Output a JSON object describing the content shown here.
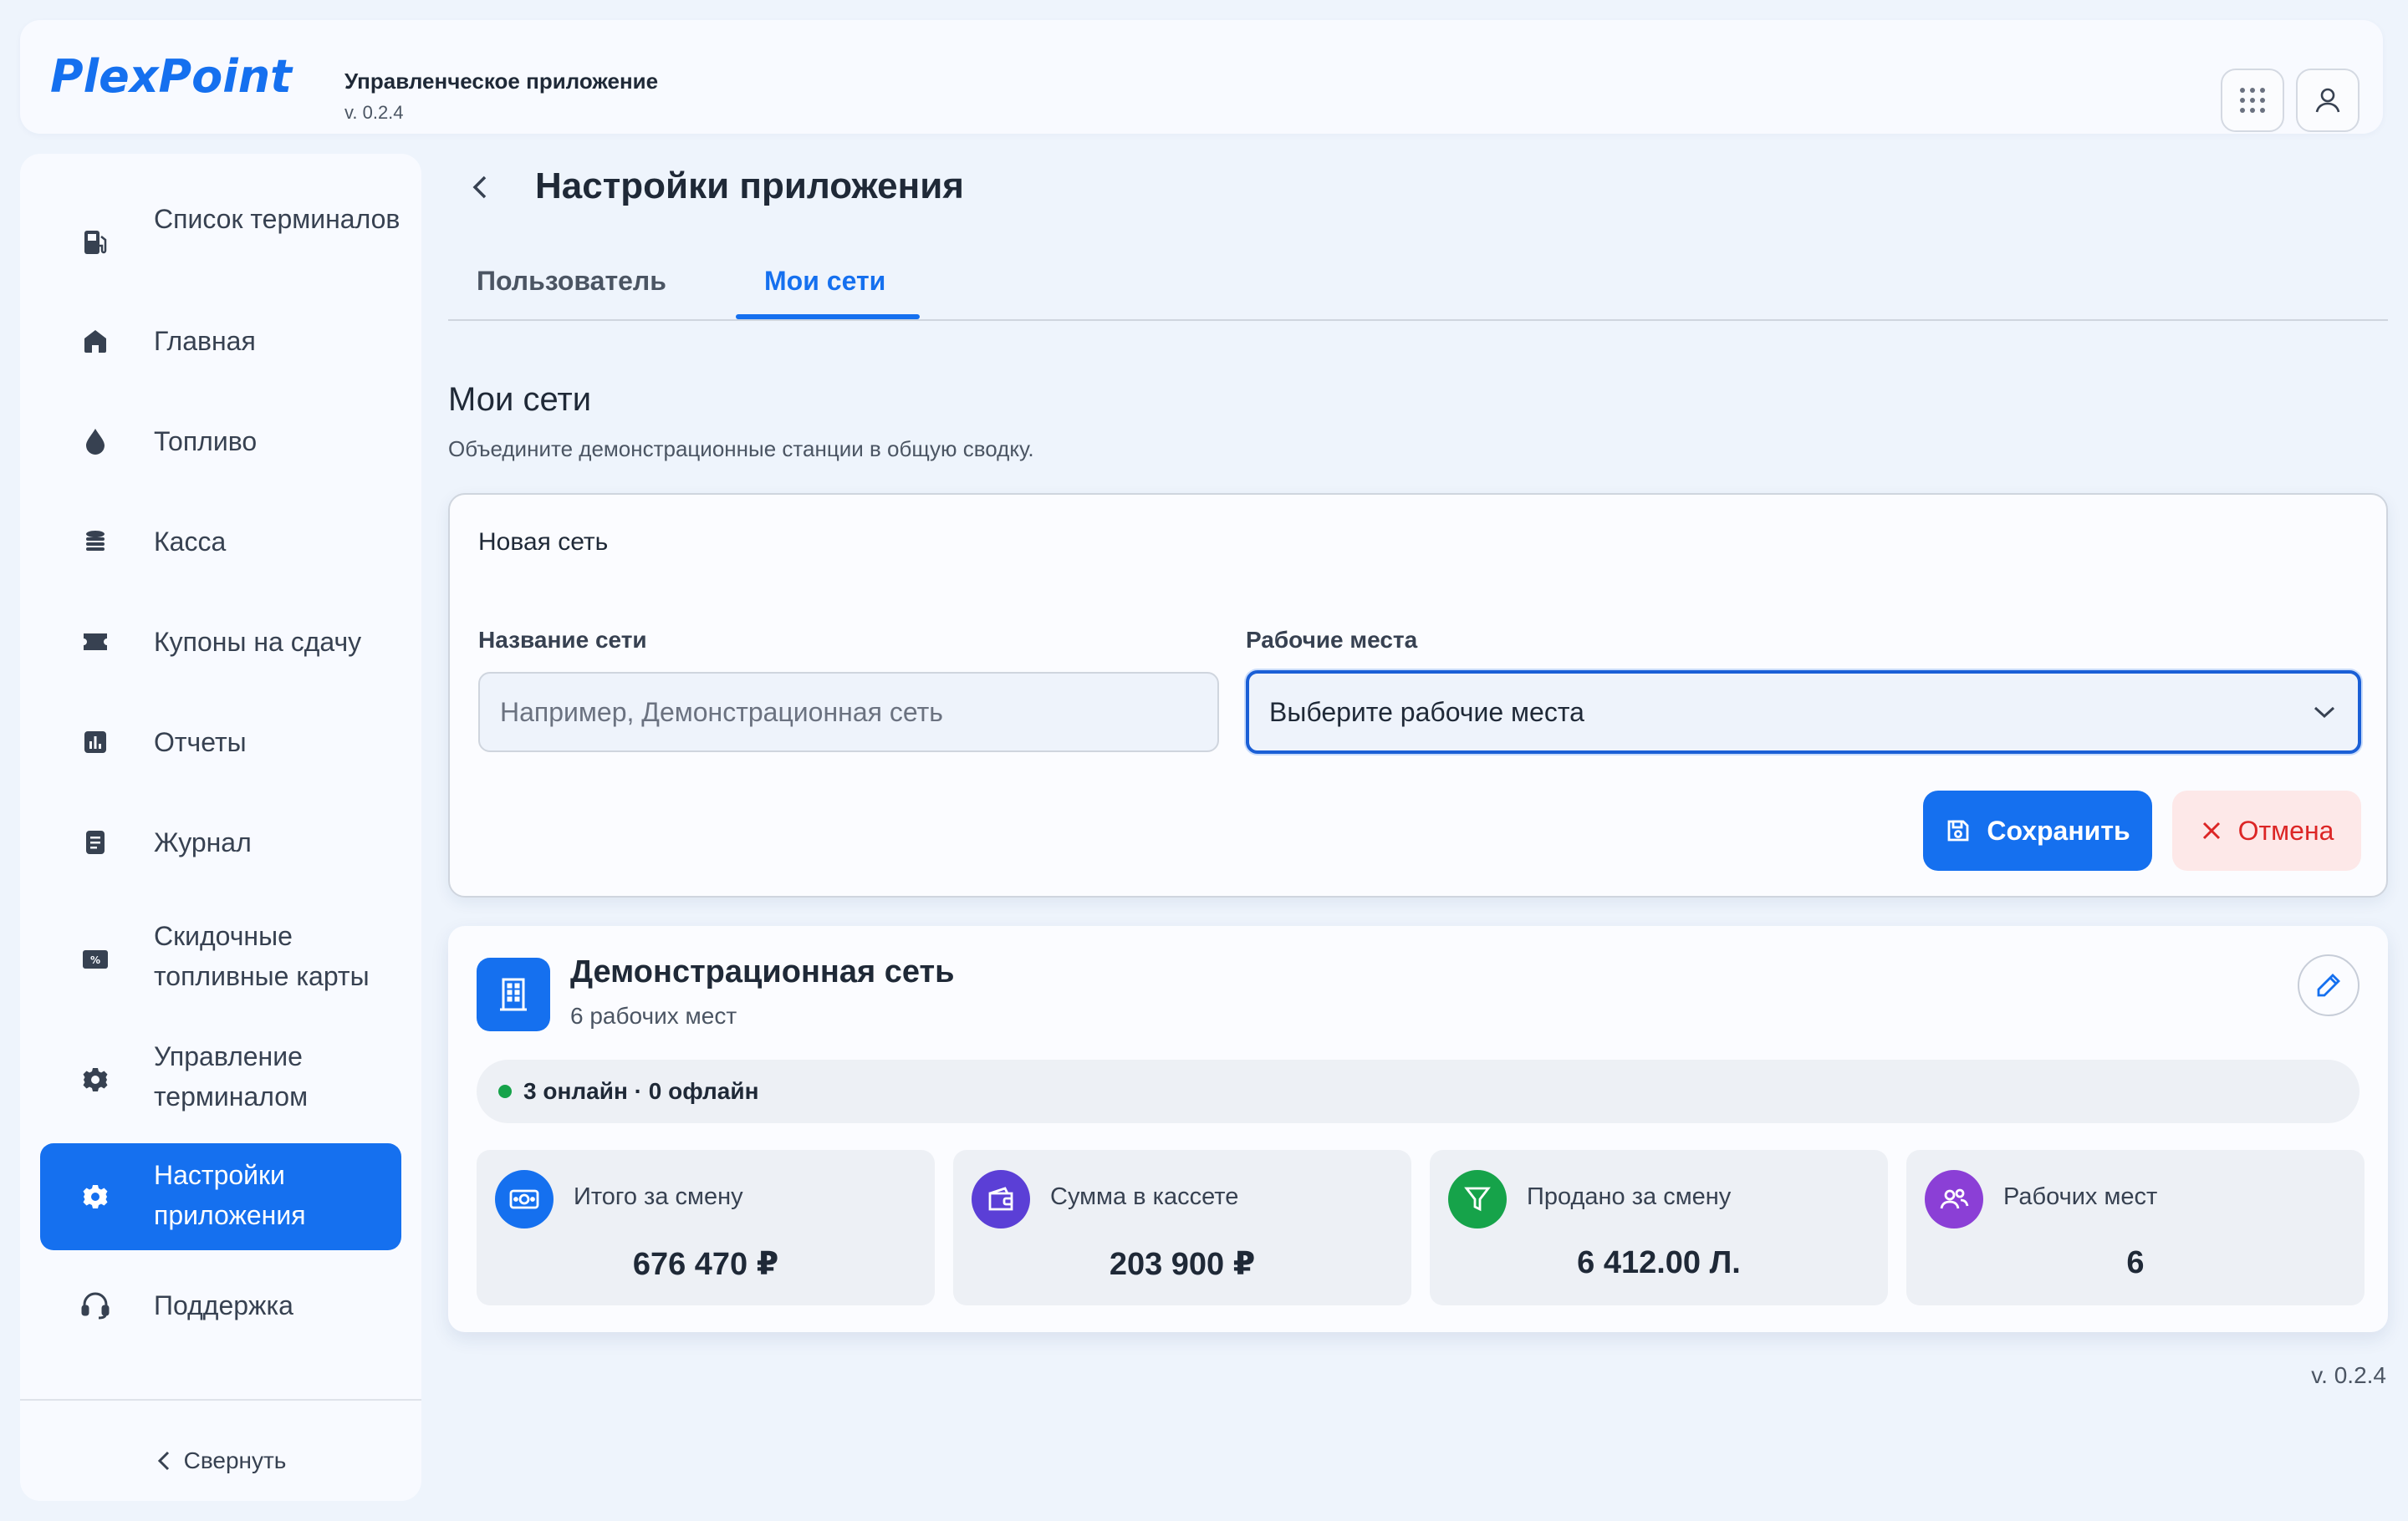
{
  "header": {
    "logo_text": "PlexPoint",
    "app_title": "Управленческое приложение",
    "version": "v. 0.2.4",
    "icons": [
      "apps-grid-icon",
      "user-icon"
    ]
  },
  "sidebar": {
    "items": [
      {
        "label": "Список терминалов",
        "icon": "fuel-pump-icon",
        "active": false
      },
      {
        "label": "Главная",
        "icon": "home-icon",
        "active": false
      },
      {
        "label": "Топливо",
        "icon": "drop-icon",
        "active": false
      },
      {
        "label": "Касса",
        "icon": "coins-stack-icon",
        "active": false
      },
      {
        "label": "Купоны на сдачу",
        "icon": "ticket-icon",
        "active": false
      },
      {
        "label": "Отчеты",
        "icon": "bar-chart-icon",
        "active": false
      },
      {
        "label": "Журнал",
        "icon": "document-icon",
        "active": false
      },
      {
        "label": "Скидочные топливные карты",
        "icon": "discount-card-icon",
        "active": false
      },
      {
        "label": "Управление терминалом",
        "icon": "gear-icon",
        "active": false
      },
      {
        "label": "Настройки приложения",
        "icon": "gear-icon",
        "active": true
      },
      {
        "label": "Поддержка",
        "icon": "headset-icon",
        "active": false
      }
    ],
    "collapse_label": "Свернуть"
  },
  "page": {
    "title": "Настройки приложения",
    "tabs": [
      {
        "label": "Пользователь",
        "active": false
      },
      {
        "label": "Мои сети",
        "active": true
      }
    ],
    "section_title": "Мои сети",
    "section_subtitle": "Объедините демонстрационные станции в общую сводку."
  },
  "new_network": {
    "title": "Новая сеть",
    "name_label": "Название сети",
    "name_placeholder": "Например, Демонстрационная сеть",
    "name_value": "",
    "places_label": "Рабочие места",
    "places_value": "Выберите рабочие места",
    "save_label": "Сохранить",
    "cancel_label": "Отмена"
  },
  "network": {
    "name": "Демонстрационная сеть",
    "workplaces": "6 рабочих мест",
    "status": "3 онлайн · 0 офлайн",
    "stats": [
      {
        "label": "Итого за смену",
        "value": "676 470 ₽",
        "icon": "cash-icon",
        "color": "#1570ef"
      },
      {
        "label": "Сумма в кассете",
        "value": "203 900 ₽",
        "icon": "wallet-icon",
        "color": "#5b3fd6"
      },
      {
        "label": "Продано за смену",
        "value": "6 412.00 Л.",
        "icon": "funnel-icon",
        "color": "#16a34a"
      },
      {
        "label": "Рабочих мест",
        "value": "6",
        "icon": "users-icon",
        "color": "#8b3fd6"
      }
    ]
  },
  "footer": {
    "version": "v. 0.2.4"
  },
  "colors": {
    "accent": "#1570ef",
    "danger": "#dc2626",
    "success": "#16a34a"
  }
}
